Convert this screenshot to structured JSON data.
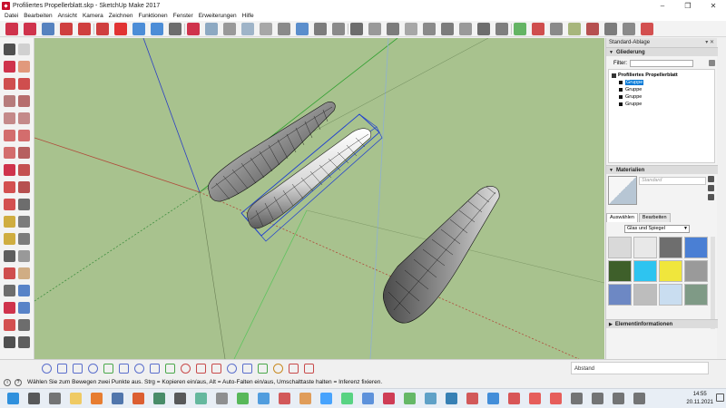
{
  "window": {
    "title": "Profiliertes Propellerblatt.skp - SketchUp Make 2017",
    "minimize": "–",
    "maximize": "❐",
    "close": "✕"
  },
  "menu": [
    "Datei",
    "Bearbeiten",
    "Ansicht",
    "Kamera",
    "Zeichnen",
    "Funktionen",
    "Fenster",
    "Erweiterungen",
    "Hilfe"
  ],
  "tray": {
    "title": "Standard-Ablage",
    "controls": "▾ ✕",
    "outliner": {
      "heading": "Gliederung",
      "filter_label": "Filter:",
      "filter_value": "",
      "root": "Profiliertes Propellerblatt",
      "items": [
        "Gruppe",
        "Gruppe",
        "Gruppe",
        "Gruppe"
      ]
    },
    "materials": {
      "heading": "Materialien",
      "current_name": "Standard",
      "tabs": [
        "Auswählen",
        "Bearbeiten"
      ],
      "collection": "Glas und Spiegel",
      "swatch_colors": [
        "#d9d9d9",
        "#e8e8e8",
        "#6e6e6e",
        "#4a7fd4",
        "#3e5f2a",
        "#2ec4f0",
        "#f0e63c",
        "#9a9a9a",
        "#6d88c4",
        "#bdbdbd",
        "#c9ddf0",
        "#7f9a86"
      ]
    },
    "entity_info": {
      "heading": "Elementinformationen"
    }
  },
  "measurements": {
    "label": "Abstand"
  },
  "statusbar": {
    "hint": "Wählen Sie zum Bewegen zwei Punkte aus. Strg = Kopieren ein/aus, Alt = Auto-Falten ein/aus, Umschalttaste halten = Inferenz fixieren."
  },
  "taskbar": {
    "time": "14:55",
    "date": "20.11.2021"
  },
  "colors": {
    "viewport_bg": "#a8c28e",
    "selection": "#1f3fd0",
    "accent": "#0078d7"
  }
}
